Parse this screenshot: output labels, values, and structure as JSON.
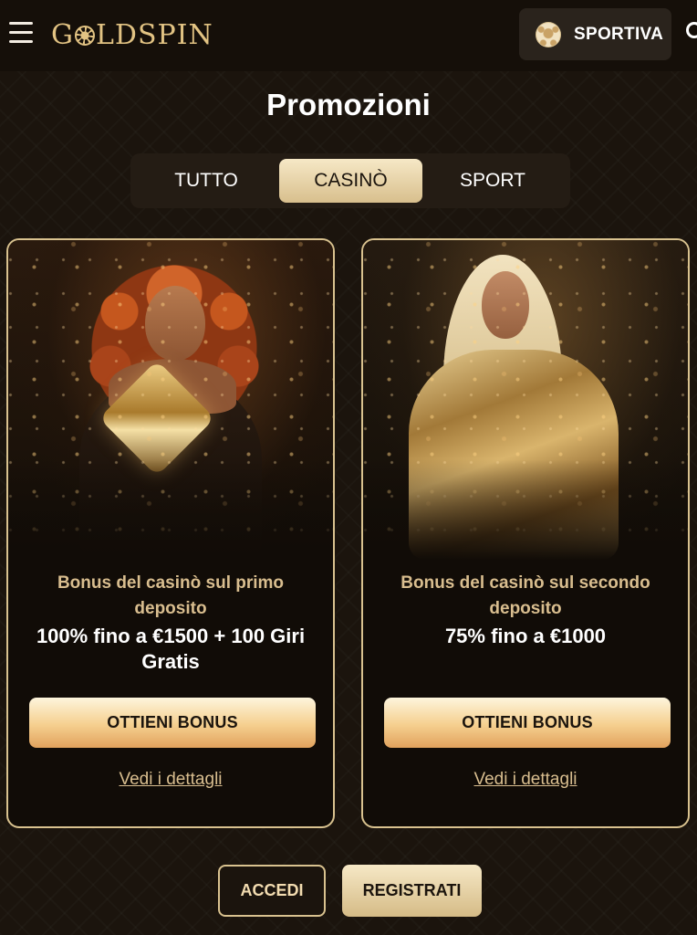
{
  "header": {
    "logo_text": "GOLDSPIN",
    "logo_left": "G",
    "logo_right": "LDSPIN",
    "menu_icon": "hamburger-menu-icon",
    "sport_button_label": "SPORTIVA",
    "sport_icon": "soccer-ball-icon",
    "search_icon": "search-icon"
  },
  "page": {
    "title": "Promozioni"
  },
  "tabs": [
    {
      "label": "TUTTO",
      "active": false
    },
    {
      "label": "CASINÒ",
      "active": true
    },
    {
      "label": "SPORT",
      "active": false
    }
  ],
  "promotions": [
    {
      "title": "Bonus del casinò sul primo deposito",
      "offer": "100% fino a €1500 + 100 Giri Gratis",
      "button_label": "OTTIENI BONUS",
      "details_label": "Vedi i dettagli"
    },
    {
      "title": "Bonus del casinò sul secondo deposito",
      "offer": "75% fino a €1000",
      "button_label": "OTTIENI BONUS",
      "details_label": "Vedi i dettagli"
    }
  ],
  "auth": {
    "login_label": "ACCEDI",
    "register_label": "REGISTRATI"
  },
  "colors": {
    "background": "#1b140d",
    "accent_gold": "#d9c28f",
    "text_gold": "#d9be8f",
    "button_gradient_top": "#fdf5dc",
    "button_gradient_bottom": "#e1a25d"
  }
}
